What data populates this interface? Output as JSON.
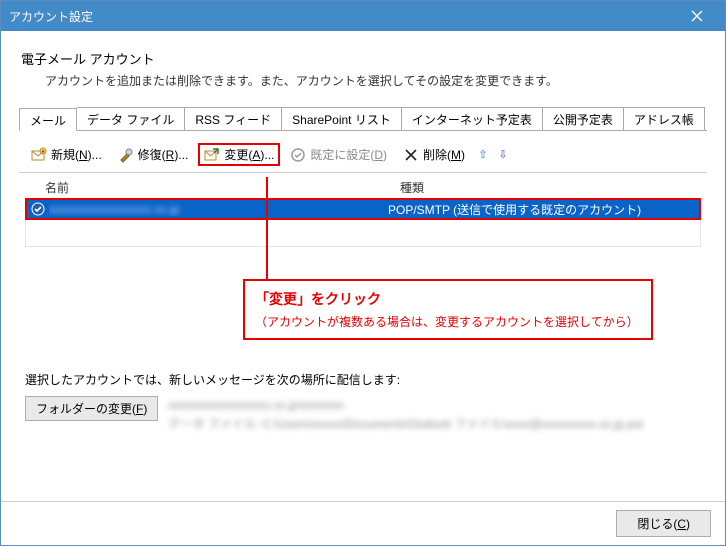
{
  "window": {
    "title": "アカウント設定",
    "close_tooltip": "閉じる"
  },
  "intro": {
    "title": "電子メール アカウント",
    "desc": "アカウントを追加または削除できます。また、アカウントを選択してその設定を変更できます。"
  },
  "tabs": [
    {
      "label": "メール",
      "active": true
    },
    {
      "label": "データ ファイル",
      "active": false
    },
    {
      "label": "RSS フィード",
      "active": false
    },
    {
      "label": "SharePoint リスト",
      "active": false
    },
    {
      "label": "インターネット予定表",
      "active": false
    },
    {
      "label": "公開予定表",
      "active": false
    },
    {
      "label": "アドレス帳",
      "active": false
    }
  ],
  "toolbar": {
    "new_label": "新規(N)...",
    "repair_label": "修復(R)...",
    "change_label": "変更(A)...",
    "set_default_label": "既定に設定(D)",
    "delete_label": "削除(M)"
  },
  "list": {
    "col_name": "名前",
    "col_type": "種類",
    "rows": [
      {
        "name_masked": "xxxxxxxxxxxxxxxxx.xx.jp",
        "type": "POP/SMTP (送信で使用する既定のアカウント)",
        "selected": true,
        "default": true
      }
    ]
  },
  "callout": {
    "title": "「変更」をクリック",
    "desc": "（アカウントが複数ある場合は、変更するアカウントを選択してから）"
  },
  "delivery": {
    "label": "選択したアカウントでは、新しいメッセージを次の場所に配信します:",
    "folder_btn": "フォルダーの変更(F)",
    "line1_masked": "xxxxxxxxxxxxxxxxx.xx.jp\\xxxxxxx",
    "line2_masked": "データ ファイル: C:\\Users\\xxxxx\\Documents\\Outlook ファイル\\xxxx@xxxxxxxxx.xx.jp.pst"
  },
  "footer": {
    "close_label": "閉じる(C)"
  },
  "colors": {
    "titlebar": "#438ac8",
    "selection": "#0a64c8",
    "annotation": "#e60000"
  }
}
